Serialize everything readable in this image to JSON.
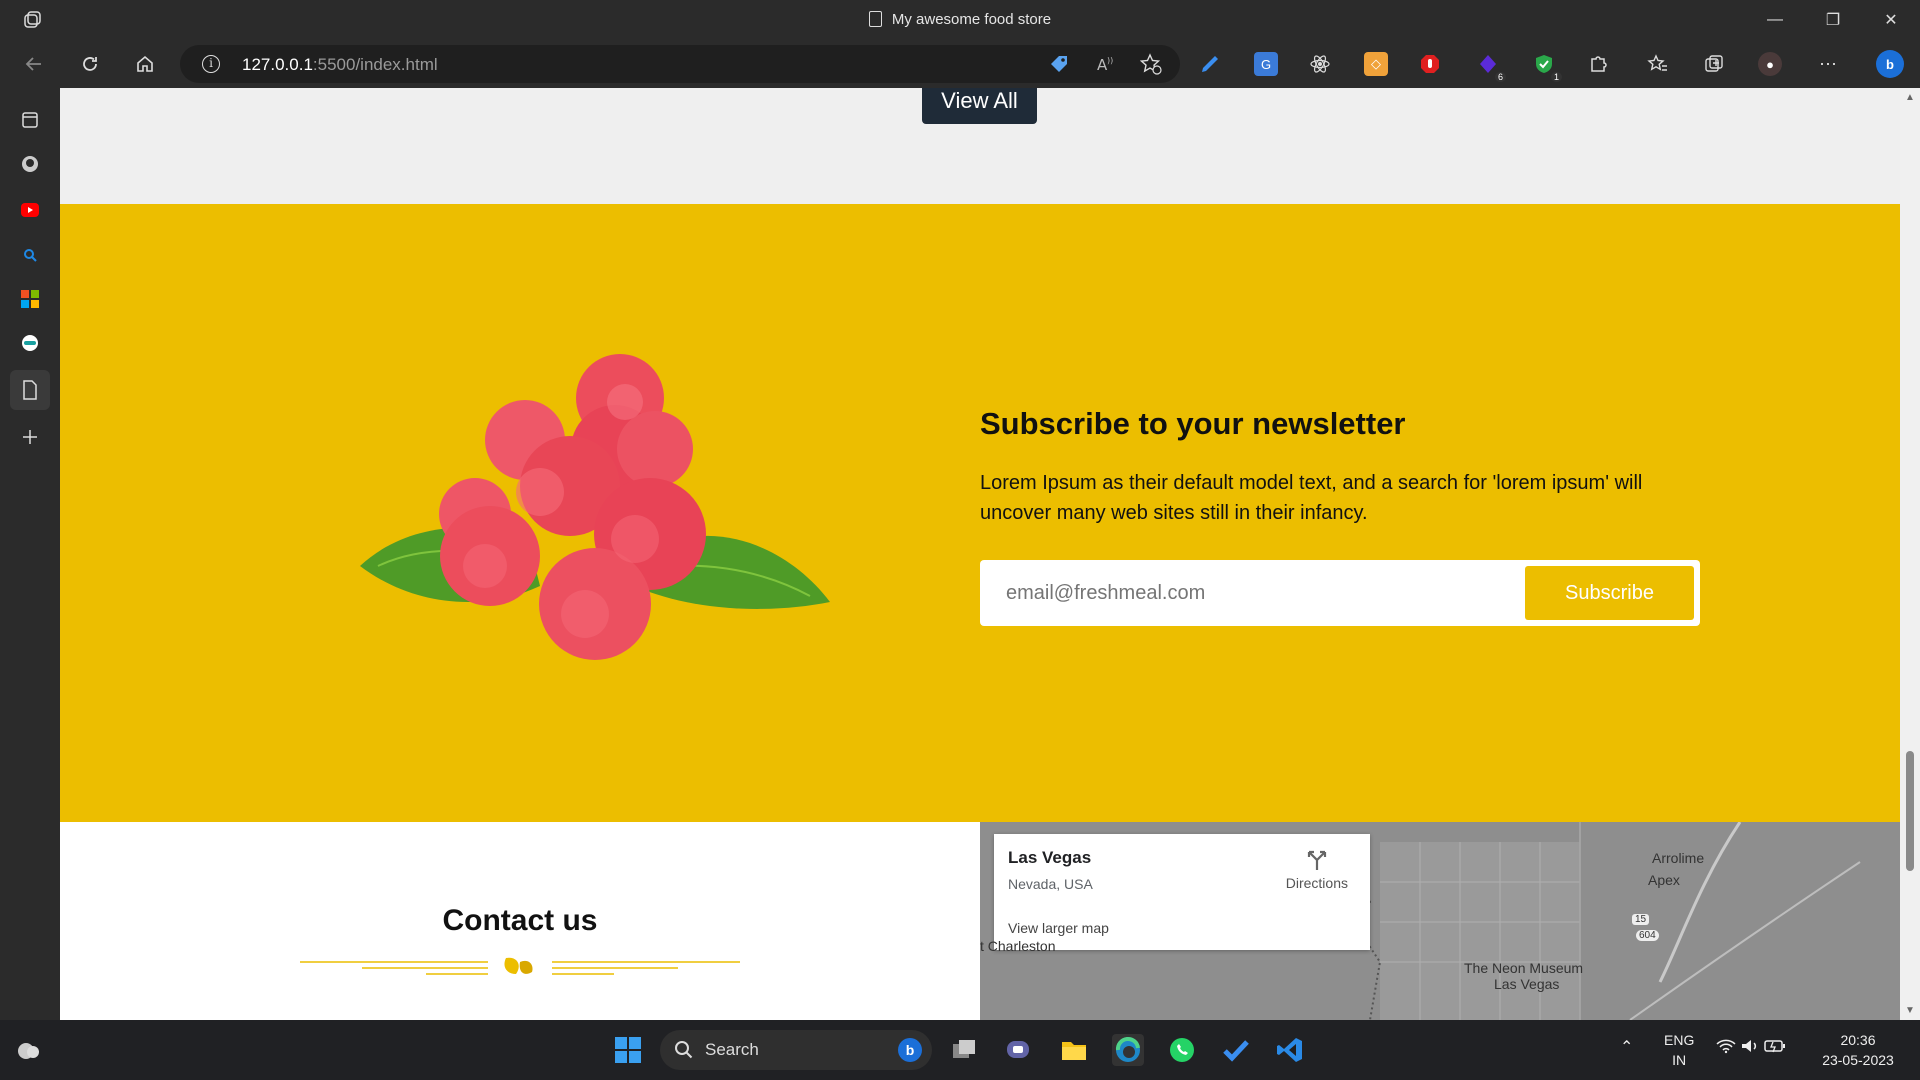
{
  "browser": {
    "tab_title": "My awesome food store",
    "url_host": "127.0.0.1",
    "url_rest": ":5500/index.html",
    "badges": {
      "ext_purple": "6",
      "ext_shield": "1"
    }
  },
  "page": {
    "view_all_label": "View All",
    "newsletter": {
      "title": "Subscribe to your newsletter",
      "text": "Lorem Ipsum as their default model text, and a search for 'lorem ipsum' will uncover many web sites still in their infancy.",
      "email_placeholder": "email@freshmeal.com",
      "subscribe_label": "Subscribe"
    },
    "contact": {
      "title": "Contact us"
    },
    "map": {
      "city": "Las Vegas",
      "region": "Nevada, USA",
      "directions_label": "Directions",
      "larger_map_label": "View larger map",
      "labels": [
        "Arrolime",
        "Apex",
        "t Charleston",
        "The Neon Museum",
        "Las Vegas",
        "604",
        "15"
      ]
    }
  },
  "taskbar": {
    "search_label": "Search",
    "lang_top": "ENG",
    "lang_bottom": "IN",
    "time": "20:36",
    "date": "23-05-2023"
  },
  "colors": {
    "accent_yellow": "#ecbe00",
    "dark_button": "#1f2b38"
  }
}
